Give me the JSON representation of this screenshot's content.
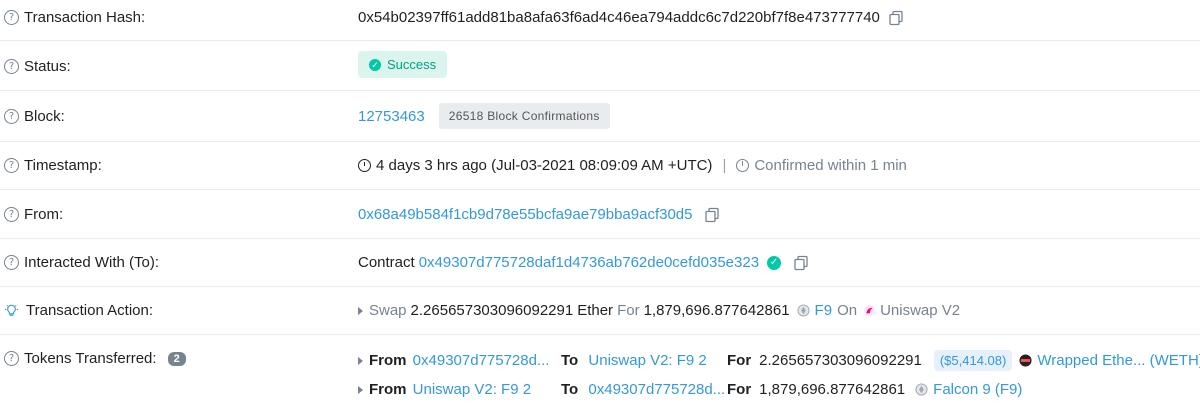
{
  "tx_hash": {
    "label": "Transaction Hash:",
    "value": "0x54b02397ff61add81ba8afa63f6ad4c46ea794addc6c7d220bf7f8e473777740"
  },
  "status": {
    "label": "Status:",
    "value": "Success",
    "color": "#00c9a7"
  },
  "block": {
    "label": "Block:",
    "number": "12753463",
    "confirmations": "26518 Block Confirmations"
  },
  "timestamp": {
    "label": "Timestamp:",
    "value": "4 days 3 hrs ago (Jul-03-2021 08:09:09 AM +UTC)",
    "separator": "|",
    "confirmed": "Confirmed within 1 min"
  },
  "from": {
    "label": "From:",
    "address": "0x68a49b584f1cb9d78e55bcfa9ae79bba9acf30d5"
  },
  "interacted": {
    "label": "Interacted With (To):",
    "prefix": "Contract",
    "address": "0x49307d775728daf1d4736ab762de0cefd035e323"
  },
  "action": {
    "label": "Transaction Action:",
    "verb": "Swap",
    "amount": "2.265657303096092291",
    "asset": "Ether",
    "for_word": "For",
    "out_amount": "1,879,696.877642861",
    "out_token": "F9",
    "on_word": "On",
    "platform": "Uniswap V2"
  },
  "tokens": {
    "label": "Tokens Transferred:",
    "count": "2",
    "transfers": [
      {
        "from_word": "From",
        "from": "0x49307d775728d...",
        "to_word": "To",
        "to": "Uniswap V2: F9 2",
        "for_word": "For",
        "amount": "2.265657303096092291",
        "usd": "($5,414.08)",
        "token": "Wrapped Ethe... (WETH)",
        "token_icon": "weth-token-icon"
      },
      {
        "from_word": "From",
        "from": "Uniswap V2: F9 2",
        "to_word": "To",
        "to": "0x49307d775728d...",
        "for_word": "For",
        "amount": "1,879,696.877642861",
        "usd": "",
        "token": "Falcon 9 (F9)",
        "token_icon": "f9-token-icon"
      }
    ]
  },
  "colors": {
    "link": "#3498db",
    "muted": "#77838f",
    "success_bg": "#dbf5ee",
    "divider": "#e7eaf3"
  }
}
